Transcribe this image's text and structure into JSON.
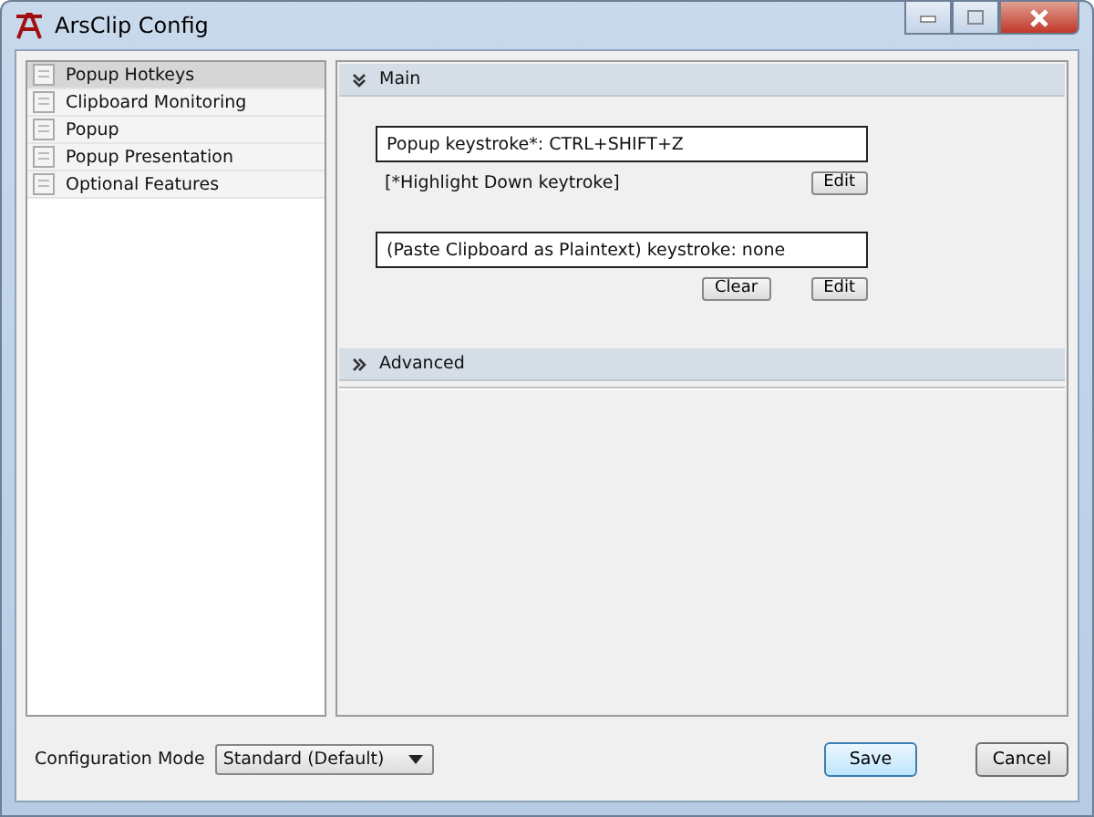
{
  "window": {
    "title": "ArsClip Config"
  },
  "sidebar": {
    "items": [
      {
        "label": "Popup Hotkeys",
        "selected": true
      },
      {
        "label": "Clipboard Monitoring",
        "selected": false
      },
      {
        "label": "Popup",
        "selected": false
      },
      {
        "label": "Popup Presentation",
        "selected": false
      },
      {
        "label": "Optional Features",
        "selected": false
      }
    ]
  },
  "sections": [
    {
      "title": "Main",
      "expanded": true,
      "groups": [
        {
          "field": "Popup keystroke*: CTRL+SHIFT+Z",
          "note": "[*Highlight Down keytroke]",
          "buttons": [
            "Edit"
          ]
        },
        {
          "field": "(Paste Clipboard as Plaintext) keystroke: none",
          "buttons": [
            "Clear",
            "Edit"
          ]
        }
      ]
    },
    {
      "title": "Advanced",
      "expanded": false
    }
  ],
  "footer": {
    "mode_label": "Configuration Mode",
    "mode_value": "Standard (Default)",
    "buttons": [
      {
        "label": "Save",
        "selected": true
      },
      {
        "label": "Cancel",
        "selected": false
      }
    ]
  }
}
